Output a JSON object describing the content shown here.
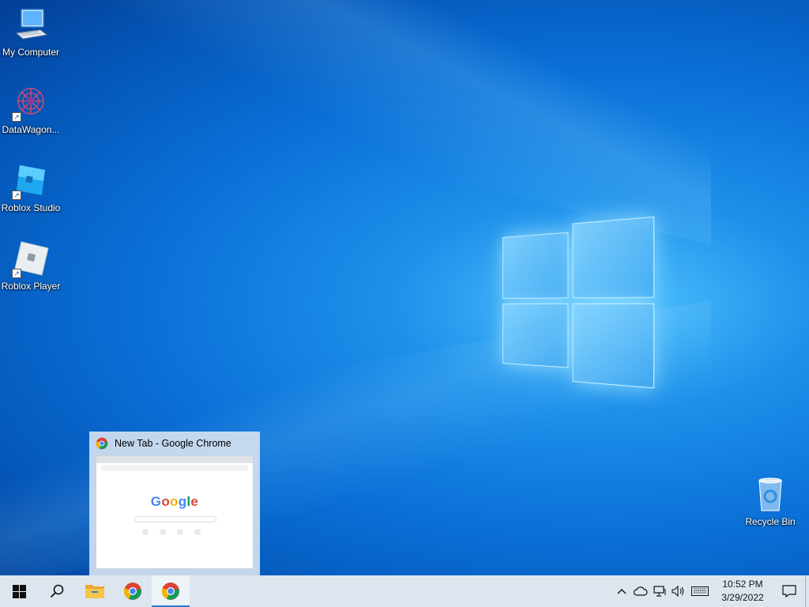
{
  "desktop": {
    "icons": [
      {
        "label": "My Computer",
        "icon": "computer-icon"
      },
      {
        "label": "DataWagon...",
        "icon": "datawagon-icon"
      },
      {
        "label": "Roblox Studio",
        "icon": "roblox-studio-icon"
      },
      {
        "label": "Roblox Player",
        "icon": "roblox-player-icon"
      },
      {
        "label": "Recycle Bin",
        "icon": "recycle-bin-icon"
      }
    ]
  },
  "preview": {
    "title": "New Tab - Google Chrome",
    "logo_text": "Google"
  },
  "taskbar": {
    "pinned": [
      "start-icon",
      "search-icon",
      "file-explorer-icon",
      "chrome-icon",
      "chrome-active-icon"
    ],
    "clock": {
      "time": "10:52 PM",
      "date": "3/29/2022"
    }
  },
  "colors": {
    "accent": "#2a7bd4",
    "taskbar_bg": "#dde6ef"
  }
}
